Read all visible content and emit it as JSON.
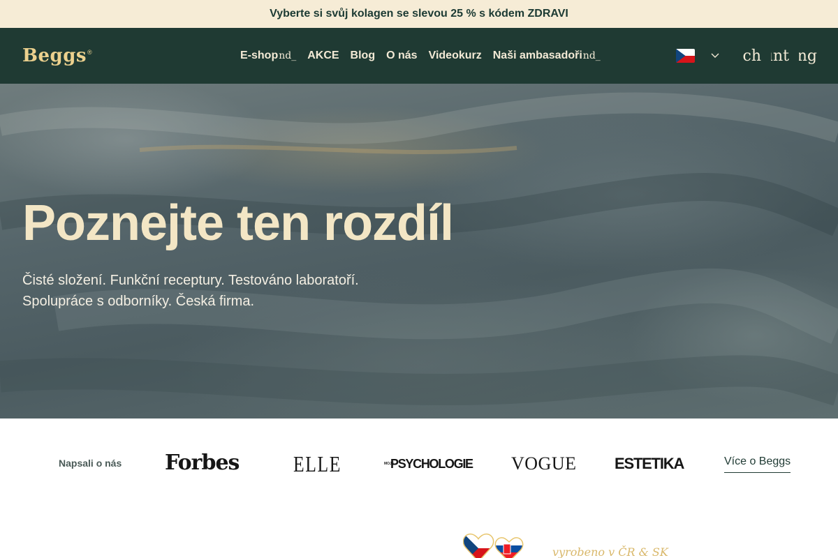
{
  "announcement": {
    "text": "Vyberte si svůj kolagen se slevou 25 % s kódem ZDRAVI"
  },
  "header": {
    "logo": "Beggs",
    "logo_mark": "®",
    "nav": [
      {
        "label": "E-shop",
        "glyph": "nd_"
      },
      {
        "label": "AKCE"
      },
      {
        "label": "Blog"
      },
      {
        "label": "O nás"
      },
      {
        "label": "Videokurz"
      },
      {
        "label": "Naši ambasadoři",
        "glyph": "nd_"
      }
    ],
    "language_flag": "flag-cz-icon",
    "icons": [
      {
        "name": "search-icon",
        "glyph": "search"
      },
      {
        "name": "account-icon",
        "glyph": "account_"
      },
      {
        "name": "cart-icon",
        "glyph": "shopping"
      }
    ],
    "colors": {
      "bg": "#1f3a33",
      "accent": "#ecd18e",
      "text": "#f3ead6"
    }
  },
  "hero": {
    "title": "Poznejte ten rozdíl",
    "subtitle_line1": "Čisté složení. Funkční receptury. Testováno laboratoří.",
    "subtitle_line2": "Spolupráce s odborníky. Česká firma."
  },
  "press": {
    "label": "Napsali o nás",
    "logos": {
      "forbes": "Forbes",
      "elle": "ELLE",
      "psychologie_small": "MOJE",
      "psychologie": "PSYCHOLOGIE",
      "vogue": "VOGUE",
      "estetika": "ESTETIKA"
    },
    "more_link": "Více o Beggs"
  },
  "made_in": {
    "text": "vyrobeno v ČR & SK"
  }
}
